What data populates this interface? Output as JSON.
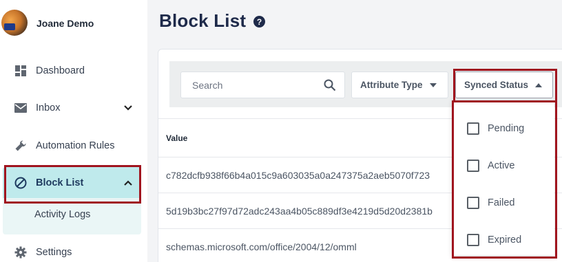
{
  "sidebar": {
    "user_name": "Joane Demo",
    "items": [
      {
        "label": "Dashboard",
        "icon": "dashboard-icon"
      },
      {
        "label": "Inbox",
        "icon": "mail-icon"
      },
      {
        "label": "Automation Rules",
        "icon": "wrench-icon"
      },
      {
        "label": "Block List",
        "icon": "block-icon"
      },
      {
        "label": "Activity Logs"
      },
      {
        "label": "Settings",
        "icon": "gear-icon"
      }
    ]
  },
  "header": {
    "title": "Block List"
  },
  "toolbar": {
    "search_placeholder": "Search",
    "attribute_type_label": "Attribute Type",
    "synced_status_label": "Synced Status"
  },
  "synced_status_options": [
    "Pending",
    "Active",
    "Failed",
    "Expired"
  ],
  "table": {
    "columns": [
      "Value"
    ],
    "rows": [
      "c782dcfb938f66b4a015c9a603035a0a247375a2aeb5070f723",
      "5d19b3bc27f97d72adc243aa4b05c889df3e4219d5d20d2381b",
      "schemas.microsoft.com/office/2004/12/omml"
    ]
  },
  "colors": {
    "active_row": "#bfeaec",
    "highlight": "#a0141e",
    "title": "#1e2a4a"
  }
}
